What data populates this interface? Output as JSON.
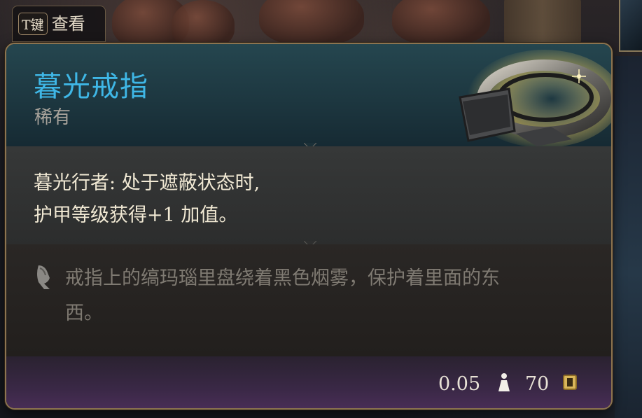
{
  "key_hint": {
    "key": "T键",
    "label": "查看"
  },
  "item": {
    "name": "暮光戒指",
    "rarity": "稀有",
    "rarity_color": "#3fb7e6",
    "effect_lines": [
      "暮光行者: 处于遮蔽状态时,",
      "护甲等级获得+1 加值。"
    ],
    "flavor_lines": [
      "戒指上的缟玛瑙里盘绕着黑色烟雾，保护着里面的东",
      "西。"
    ],
    "weight": "0.05",
    "price": "70"
  },
  "icons": {
    "item_image": "ring-icon",
    "flavor": "quill-icon",
    "weight": "weight-icon",
    "value": "gold-coin-icon"
  }
}
